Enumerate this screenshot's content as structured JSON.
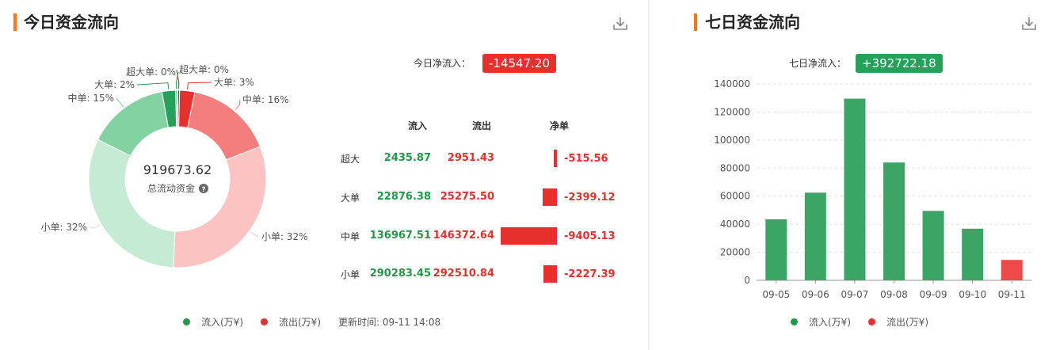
{
  "left": {
    "title": "今日资金流向",
    "net_label": "今日净流入：",
    "net_value": "-14547.20",
    "center_value": "919673.62",
    "center_label": "总流动资金",
    "table": {
      "headers": [
        "流入",
        "流出",
        "净单"
      ],
      "rows": [
        {
          "label": "超大",
          "in": "2435.87",
          "out": "2951.43",
          "net": "-515.56",
          "net_num": -515.56
        },
        {
          "label": "大单",
          "in": "22876.38",
          "out": "25275.50",
          "net": "-2399.12",
          "net_num": -2399.12
        },
        {
          "label": "中单",
          "in": "136967.51",
          "out": "146372.64",
          "net": "-9405.13",
          "net_num": -9405.13
        },
        {
          "label": "小单",
          "in": "290283.45",
          "out": "292510.84",
          "net": "-2227.39",
          "net_num": -2227.39
        }
      ]
    },
    "legend": {
      "inflow": "流入(万¥)",
      "outflow": "流出(万¥)",
      "updated": "更新时间: 09-11 14:08"
    }
  },
  "right": {
    "title": "七日资金流向",
    "net_label": "七日净流入：",
    "net_value": "+392722.18",
    "legend": {
      "inflow": "流入(万¥)",
      "outflow": "流出(万¥)"
    }
  },
  "colors": {
    "accent": "#f07a1a",
    "inflow_green": "#1f9a47",
    "outflow_red": "#e5302e",
    "bar_green": "#3aa565",
    "bar_red": "#ee4a4a"
  },
  "chart_data": [
    {
      "type": "pie",
      "slices": [
        {
          "label": "超大单: 0%",
          "value": 2435.87,
          "group": "inflow",
          "color": "#1fa64f"
        },
        {
          "label": "大单: 2%",
          "value": 22876.38,
          "group": "inflow",
          "color": "#27a05a"
        },
        {
          "label": "中单: 15%",
          "value": 136967.51,
          "group": "inflow",
          "color": "#82d2a2"
        },
        {
          "label": "小单: 32%",
          "value": 290283.45,
          "group": "inflow",
          "color": "#c6ebd5"
        },
        {
          "label": "小单: 32%",
          "value": 292510.84,
          "group": "outflow",
          "color": "#fcc3c3"
        },
        {
          "label": "中单: 16%",
          "value": 146372.64,
          "group": "outflow",
          "color": "#f47d7d"
        },
        {
          "label": "大单: 3%",
          "value": 25275.5,
          "group": "outflow",
          "color": "#e5302e"
        },
        {
          "label": "超大单: 0%",
          "value": 2951.43,
          "group": "outflow",
          "color": "#c41d1d"
        }
      ]
    },
    {
      "type": "bar",
      "categories": [
        "09-05",
        "09-06",
        "09-07",
        "09-08",
        "09-09",
        "09-10",
        "09-11"
      ],
      "values": [
        43500,
        62500,
        129500,
        84000,
        49500,
        36800,
        14547.2
      ],
      "direction": [
        "inflow",
        "inflow",
        "inflow",
        "inflow",
        "inflow",
        "inflow",
        "outflow"
      ],
      "ylim": [
        0,
        140000
      ],
      "yticks": [
        0,
        20000,
        40000,
        60000,
        80000,
        100000,
        120000,
        140000
      ],
      "grid": true,
      "legend": "bottom"
    }
  ]
}
